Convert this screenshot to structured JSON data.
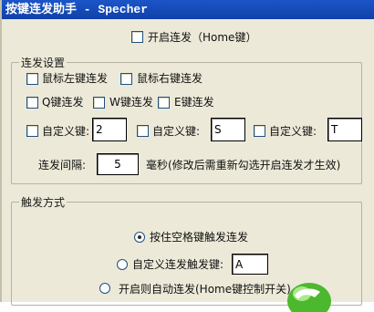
{
  "window": {
    "title": "按键连发助手 - Specher"
  },
  "master": {
    "enable_label": "开启连发（Home键）"
  },
  "settings_group": {
    "title": "连发设置",
    "mouse_left_label": "鼠标左键连发",
    "mouse_right_label": "鼠标右键连发",
    "q_label": "Q键连发",
    "w_label": "W键连发",
    "e_label": "E键连发",
    "custom_key_label": "自定义键:",
    "custom_key_1": "2",
    "custom_key_2": "S",
    "custom_key_3": "T",
    "interval_label": "连发间隔:",
    "interval_value": "5",
    "interval_note": "毫秒(修改后需重新勾选开启连发才生效)"
  },
  "trigger_group": {
    "title": "触发方式",
    "option_space": "按住空格键触发连发",
    "option_custom": "自定义连发触发键:",
    "custom_trigger_key": "A",
    "option_auto": "开启则自动连发(Home键控制开关)",
    "selected": "按住空格键触发连发"
  }
}
